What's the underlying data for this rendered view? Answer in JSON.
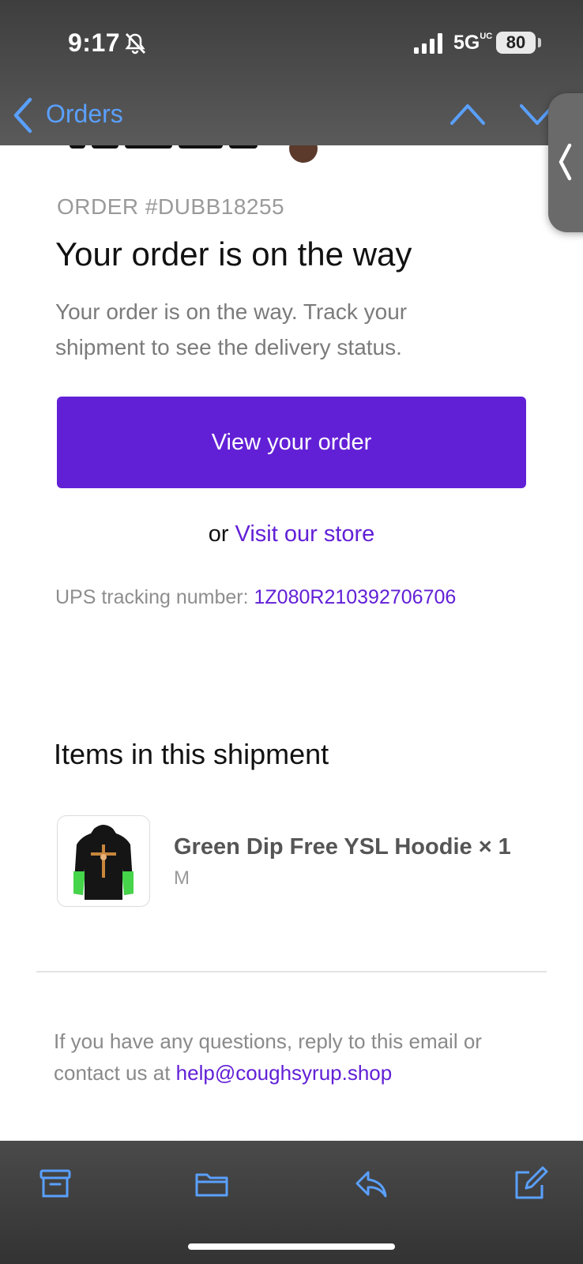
{
  "status_bar": {
    "time": "9:17",
    "network": "5G",
    "network_sup": "UC",
    "battery": "80"
  },
  "nav": {
    "back_label": "Orders"
  },
  "email": {
    "order_number": "ORDER #DUBB18255",
    "headline": "Your order is on the way",
    "description": "Your order is on the way. Track your shipment to see the delivery status.",
    "view_button": "View your order",
    "or_text": "or",
    "store_link": "Visit our store",
    "tracking_label": "UPS tracking number:",
    "tracking_number": "1Z080R210392706706",
    "items_title": "Items in this shipment",
    "items": [
      {
        "name": "Green Dip Free YSL Hoodie × 1",
        "variant": "M"
      }
    ],
    "footer_text": "If you have any questions, reply to this email or contact us at",
    "footer_email": "help@coughsyrup.shop"
  },
  "toolbar": {
    "icons": [
      "archive-icon",
      "folder-icon",
      "reply-icon",
      "compose-icon"
    ]
  },
  "colors": {
    "accent": "#6220d6",
    "ios_blue": "#5aa0ff"
  }
}
